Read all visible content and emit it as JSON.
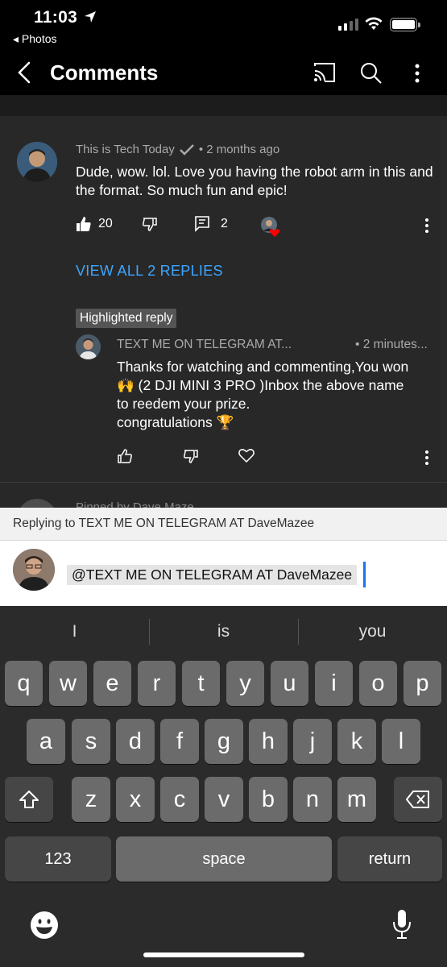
{
  "status_bar": {
    "time": "11:03",
    "back_app": "◂ Photos"
  },
  "header": {
    "title": "Comments",
    "icons": [
      "back-chevron-icon",
      "cast-icon",
      "search-icon",
      "more-vert-icon"
    ]
  },
  "comment": {
    "author": "This is Tech Today",
    "time": "• 2 months ago",
    "text": "Dude, wow. lol. Love you having the robot arm in this and the format. So much fun and epic!",
    "likes": "20",
    "replies_count": "2",
    "view_replies_label": "VIEW ALL 2 REPLIES"
  },
  "highlighted_reply": {
    "badge": "Highlighted reply",
    "author": "TEXT ME ON TELEGRAM AT...",
    "time": "• 2 minutes...",
    "line1": "Thanks for watching and commenting,You won",
    "line2": "🙌 (2 DJI MINI 3 PRO  )Inbox the above name",
    "line3": "to reedem your prize.",
    "line4": "congratulations 🏆"
  },
  "next_comment_peek": "Pinned by Dave Maze",
  "composer": {
    "replying_to": "Replying to TEXT ME ON TELEGRAM AT DaveMazee",
    "input_value": "@TEXT ME ON TELEGRAM AT DaveMazee"
  },
  "keyboard": {
    "suggestions": [
      "I",
      "is",
      "you"
    ],
    "row1": [
      "q",
      "w",
      "e",
      "r",
      "t",
      "y",
      "u",
      "i",
      "o",
      "p"
    ],
    "row2": [
      "a",
      "s",
      "d",
      "f",
      "g",
      "h",
      "j",
      "k",
      "l"
    ],
    "row3": [
      "z",
      "x",
      "c",
      "v",
      "b",
      "n",
      "m"
    ],
    "numbers_label": "123",
    "space_label": "space",
    "return_label": "return"
  },
  "colors": {
    "accent_link": "#3ea6ff",
    "cursor": "#1a73e8",
    "heart": "#ff0000"
  }
}
